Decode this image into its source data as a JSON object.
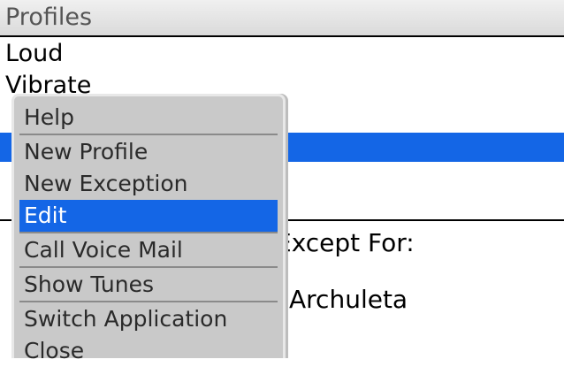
{
  "title_bar": {
    "title": "Profiles"
  },
  "profiles_list": {
    "items": [
      "Loud",
      "Vibrate"
    ]
  },
  "background": {
    "except_label": "Except For:",
    "exception_contact": "Archuleta"
  },
  "menu": {
    "groups": [
      [
        {
          "label": "Help"
        }
      ],
      [
        {
          "label": "New Profile"
        },
        {
          "label": "New Exception"
        },
        {
          "label": "Edit",
          "selected": true
        }
      ],
      [
        {
          "label": "Call Voice Mail"
        }
      ],
      [
        {
          "label": "Show Tunes"
        }
      ],
      [
        {
          "label": "Switch Application"
        },
        {
          "label": "Close"
        }
      ]
    ]
  },
  "colors": {
    "selection": "#1466e6",
    "menu_background": "#c9c9c9",
    "title_text": "#555555"
  }
}
